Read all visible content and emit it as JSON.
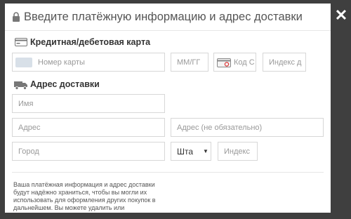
{
  "header": {
    "title": "Введите платёжную информацию и адрес доставки"
  },
  "card_section": {
    "title": "Кредитная/дебетовая карта"
  },
  "card_fields": {
    "card_number_placeholder": "Номер карты",
    "expiry_placeholder": "ММ/ГГ",
    "cvc_placeholder": "Код С",
    "zip_placeholder": "Индекс д"
  },
  "shipping_section": {
    "title": "Адрес доставки"
  },
  "shipping_fields": {
    "name_placeholder": "Имя",
    "address_placeholder": "Адрес",
    "address2_placeholder": "Адрес (не обязательно)",
    "city_placeholder": "Город",
    "state_value": "Шта",
    "postal_placeholder": "Индекс"
  },
  "footer": {
    "line1": "Ваша платёжная информация и адрес доставки",
    "line2": "будут надёжно храниться, чтобы вы могли их",
    "line3": "использовать для оформления других покупок в",
    "line4": "дальнейшем. Вы можете удалить или"
  },
  "icons": {
    "lock": "lock-icon",
    "close": "close-icon",
    "card": "credit-card-icon",
    "truck": "truck-icon",
    "cvc": "cvc-card-icon",
    "dropdown": "chevron-down-icon"
  }
}
